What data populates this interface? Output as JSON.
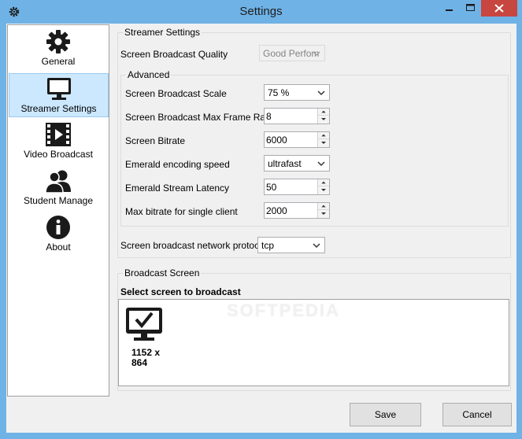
{
  "window": {
    "title": "Settings",
    "accent_color": "#6fb2e6",
    "close_color": "#c7463f"
  },
  "sidebar": {
    "items": [
      {
        "label": "General",
        "icon": "gear-icon",
        "selected": false
      },
      {
        "label": "Streamer Settings",
        "icon": "monitor-icon",
        "selected": true
      },
      {
        "label": "Video Broadcast",
        "icon": "film-icon",
        "selected": false
      },
      {
        "label": "Student Manage",
        "icon": "users-icon",
        "selected": false
      },
      {
        "label": "About",
        "icon": "info-icon",
        "selected": false
      }
    ],
    "selected_color": "#cce8ff"
  },
  "streamer": {
    "group_title": "Streamer Settings",
    "quality_label": "Screen Broadcast Quality",
    "quality_value": "Good Perfom",
    "advanced": {
      "group_title": "Advanced",
      "scale_label": "Screen Broadcast Scale",
      "scale_value": "75 %",
      "framerate_label": "Screen Broadcast Max Frame Rate",
      "framerate_value": "8",
      "bitrate_label": "Screen Bitrate",
      "bitrate_value": "6000",
      "encoding_label": "Emerald encoding speed",
      "encoding_value": "ultrafast",
      "latency_label": "Emerald Stream Latency",
      "latency_value": "50",
      "maxbitrate_label": "Max bitrate for single client",
      "maxbitrate_value": "2000"
    },
    "protocol_label": "Screen broadcast network protocol",
    "protocol_value": "tcp"
  },
  "broadcast": {
    "group_title": "Broadcast Screen",
    "select_label": "Select screen to broadcast",
    "screen_caption": "1152 x 864"
  },
  "watermark": "SOFTPEDIA",
  "buttons": {
    "save": "Save",
    "cancel": "Cancel"
  }
}
